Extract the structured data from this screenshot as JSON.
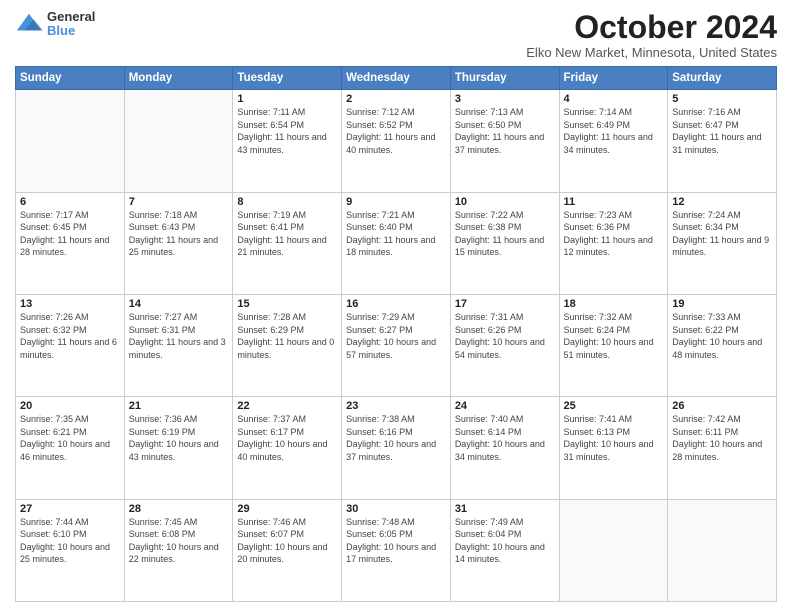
{
  "header": {
    "logo_general": "General",
    "logo_blue": "Blue",
    "title": "October 2024",
    "location": "Elko New Market, Minnesota, United States"
  },
  "days_of_week": [
    "Sunday",
    "Monday",
    "Tuesday",
    "Wednesday",
    "Thursday",
    "Friday",
    "Saturday"
  ],
  "weeks": [
    [
      {
        "day": "",
        "sunrise": "",
        "sunset": "",
        "daylight": ""
      },
      {
        "day": "",
        "sunrise": "",
        "sunset": "",
        "daylight": ""
      },
      {
        "day": "1",
        "sunrise": "Sunrise: 7:11 AM",
        "sunset": "Sunset: 6:54 PM",
        "daylight": "Daylight: 11 hours and 43 minutes."
      },
      {
        "day": "2",
        "sunrise": "Sunrise: 7:12 AM",
        "sunset": "Sunset: 6:52 PM",
        "daylight": "Daylight: 11 hours and 40 minutes."
      },
      {
        "day": "3",
        "sunrise": "Sunrise: 7:13 AM",
        "sunset": "Sunset: 6:50 PM",
        "daylight": "Daylight: 11 hours and 37 minutes."
      },
      {
        "day": "4",
        "sunrise": "Sunrise: 7:14 AM",
        "sunset": "Sunset: 6:49 PM",
        "daylight": "Daylight: 11 hours and 34 minutes."
      },
      {
        "day": "5",
        "sunrise": "Sunrise: 7:16 AM",
        "sunset": "Sunset: 6:47 PM",
        "daylight": "Daylight: 11 hours and 31 minutes."
      }
    ],
    [
      {
        "day": "6",
        "sunrise": "Sunrise: 7:17 AM",
        "sunset": "Sunset: 6:45 PM",
        "daylight": "Daylight: 11 hours and 28 minutes."
      },
      {
        "day": "7",
        "sunrise": "Sunrise: 7:18 AM",
        "sunset": "Sunset: 6:43 PM",
        "daylight": "Daylight: 11 hours and 25 minutes."
      },
      {
        "day": "8",
        "sunrise": "Sunrise: 7:19 AM",
        "sunset": "Sunset: 6:41 PM",
        "daylight": "Daylight: 11 hours and 21 minutes."
      },
      {
        "day": "9",
        "sunrise": "Sunrise: 7:21 AM",
        "sunset": "Sunset: 6:40 PM",
        "daylight": "Daylight: 11 hours and 18 minutes."
      },
      {
        "day": "10",
        "sunrise": "Sunrise: 7:22 AM",
        "sunset": "Sunset: 6:38 PM",
        "daylight": "Daylight: 11 hours and 15 minutes."
      },
      {
        "day": "11",
        "sunrise": "Sunrise: 7:23 AM",
        "sunset": "Sunset: 6:36 PM",
        "daylight": "Daylight: 11 hours and 12 minutes."
      },
      {
        "day": "12",
        "sunrise": "Sunrise: 7:24 AM",
        "sunset": "Sunset: 6:34 PM",
        "daylight": "Daylight: 11 hours and 9 minutes."
      }
    ],
    [
      {
        "day": "13",
        "sunrise": "Sunrise: 7:26 AM",
        "sunset": "Sunset: 6:32 PM",
        "daylight": "Daylight: 11 hours and 6 minutes."
      },
      {
        "day": "14",
        "sunrise": "Sunrise: 7:27 AM",
        "sunset": "Sunset: 6:31 PM",
        "daylight": "Daylight: 11 hours and 3 minutes."
      },
      {
        "day": "15",
        "sunrise": "Sunrise: 7:28 AM",
        "sunset": "Sunset: 6:29 PM",
        "daylight": "Daylight: 11 hours and 0 minutes."
      },
      {
        "day": "16",
        "sunrise": "Sunrise: 7:29 AM",
        "sunset": "Sunset: 6:27 PM",
        "daylight": "Daylight: 10 hours and 57 minutes."
      },
      {
        "day": "17",
        "sunrise": "Sunrise: 7:31 AM",
        "sunset": "Sunset: 6:26 PM",
        "daylight": "Daylight: 10 hours and 54 minutes."
      },
      {
        "day": "18",
        "sunrise": "Sunrise: 7:32 AM",
        "sunset": "Sunset: 6:24 PM",
        "daylight": "Daylight: 10 hours and 51 minutes."
      },
      {
        "day": "19",
        "sunrise": "Sunrise: 7:33 AM",
        "sunset": "Sunset: 6:22 PM",
        "daylight": "Daylight: 10 hours and 48 minutes."
      }
    ],
    [
      {
        "day": "20",
        "sunrise": "Sunrise: 7:35 AM",
        "sunset": "Sunset: 6:21 PM",
        "daylight": "Daylight: 10 hours and 46 minutes."
      },
      {
        "day": "21",
        "sunrise": "Sunrise: 7:36 AM",
        "sunset": "Sunset: 6:19 PM",
        "daylight": "Daylight: 10 hours and 43 minutes."
      },
      {
        "day": "22",
        "sunrise": "Sunrise: 7:37 AM",
        "sunset": "Sunset: 6:17 PM",
        "daylight": "Daylight: 10 hours and 40 minutes."
      },
      {
        "day": "23",
        "sunrise": "Sunrise: 7:38 AM",
        "sunset": "Sunset: 6:16 PM",
        "daylight": "Daylight: 10 hours and 37 minutes."
      },
      {
        "day": "24",
        "sunrise": "Sunrise: 7:40 AM",
        "sunset": "Sunset: 6:14 PM",
        "daylight": "Daylight: 10 hours and 34 minutes."
      },
      {
        "day": "25",
        "sunrise": "Sunrise: 7:41 AM",
        "sunset": "Sunset: 6:13 PM",
        "daylight": "Daylight: 10 hours and 31 minutes."
      },
      {
        "day": "26",
        "sunrise": "Sunrise: 7:42 AM",
        "sunset": "Sunset: 6:11 PM",
        "daylight": "Daylight: 10 hours and 28 minutes."
      }
    ],
    [
      {
        "day": "27",
        "sunrise": "Sunrise: 7:44 AM",
        "sunset": "Sunset: 6:10 PM",
        "daylight": "Daylight: 10 hours and 25 minutes."
      },
      {
        "day": "28",
        "sunrise": "Sunrise: 7:45 AM",
        "sunset": "Sunset: 6:08 PM",
        "daylight": "Daylight: 10 hours and 22 minutes."
      },
      {
        "day": "29",
        "sunrise": "Sunrise: 7:46 AM",
        "sunset": "Sunset: 6:07 PM",
        "daylight": "Daylight: 10 hours and 20 minutes."
      },
      {
        "day": "30",
        "sunrise": "Sunrise: 7:48 AM",
        "sunset": "Sunset: 6:05 PM",
        "daylight": "Daylight: 10 hours and 17 minutes."
      },
      {
        "day": "31",
        "sunrise": "Sunrise: 7:49 AM",
        "sunset": "Sunset: 6:04 PM",
        "daylight": "Daylight: 10 hours and 14 minutes."
      },
      {
        "day": "",
        "sunrise": "",
        "sunset": "",
        "daylight": ""
      },
      {
        "day": "",
        "sunrise": "",
        "sunset": "",
        "daylight": ""
      }
    ]
  ]
}
